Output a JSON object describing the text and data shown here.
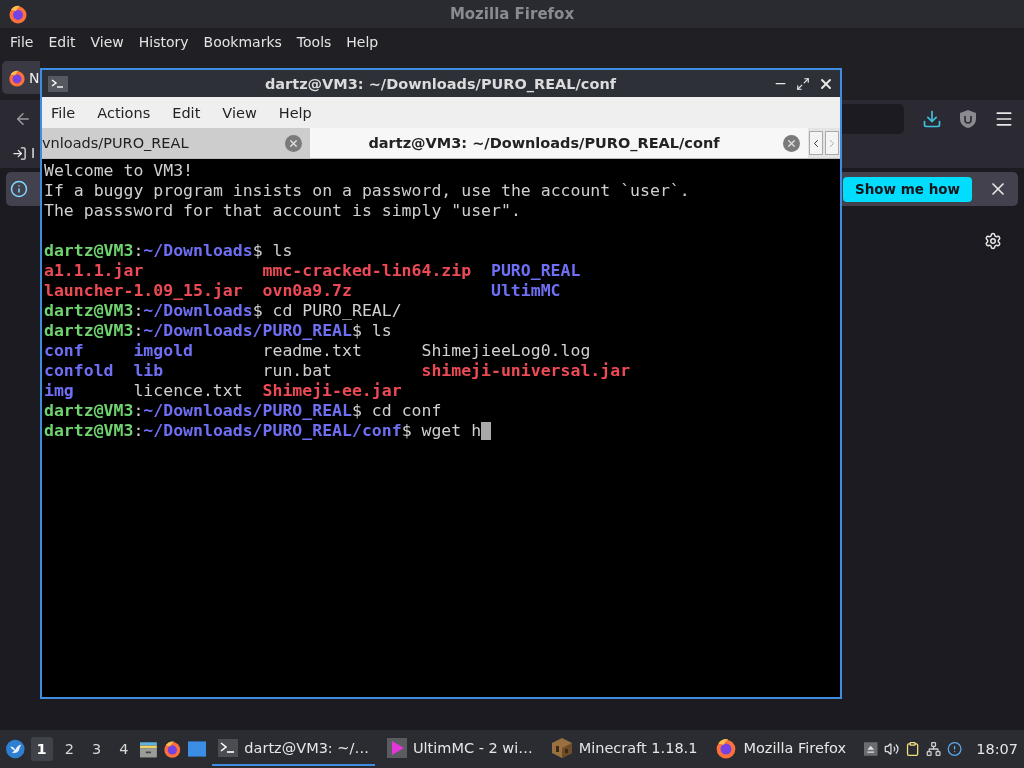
{
  "firefox": {
    "title": "Mozilla Firefox",
    "menu": [
      "File",
      "Edit",
      "View",
      "History",
      "Bookmarks",
      "Tools",
      "Help"
    ],
    "tab": {
      "label": "N",
      "selected": true
    },
    "bookmark": {
      "label": "I"
    },
    "notification": {
      "button": "Show me how"
    }
  },
  "terminal": {
    "title": "dartz@VM3: ~/Downloads/PURO_REAL/conf",
    "menu": [
      "File",
      "Actions",
      "Edit",
      "View",
      "Help"
    ],
    "tabs": [
      {
        "label": "vnloads/PURO_REAL",
        "selected": false
      },
      {
        "label": "dartz@VM3: ~/Downloads/PURO_REAL/conf",
        "selected": true
      }
    ],
    "lines": [
      {
        "kind": "text",
        "text": "Welcome to VM3!"
      },
      {
        "kind": "text",
        "text": "If a buggy program insists on a password, use the account `user`."
      },
      {
        "kind": "text",
        "text": "The passsword for that account is simply \"user\"."
      },
      {
        "kind": "blank"
      },
      {
        "kind": "prompt",
        "user": "dartz@VM3",
        "separator": ":",
        "path": "~/Downloads",
        "command": "$ ls",
        "cursor": false
      },
      {
        "kind": "listing",
        "rows": [
          [
            {
              "name": "a1.1.1.jar",
              "kind": "archive"
            },
            {
              "name": "mmc-cracked-lin64.zip",
              "kind": "archive"
            },
            {
              "name": "PURO_REAL",
              "kind": "dir"
            }
          ],
          [
            {
              "name": "launcher-1.09_15.jar",
              "kind": "archive"
            },
            {
              "name": "ovn0a9.7z",
              "kind": "archive"
            },
            {
              "name": "UltimMC",
              "kind": "dir"
            }
          ]
        ]
      },
      {
        "kind": "prompt",
        "user": "dartz@VM3",
        "separator": ":",
        "path": "~/Downloads",
        "command": "$ cd PURO_REAL/",
        "cursor": false
      },
      {
        "kind": "prompt",
        "user": "dartz@VM3",
        "separator": ":",
        "path": "~/Downloads/PURO_REAL",
        "command": "$ ls",
        "cursor": false
      },
      {
        "kind": "listing",
        "rows": [
          [
            {
              "name": "conf",
              "kind": "dir"
            },
            {
              "name": "imgold",
              "kind": "dir"
            },
            {
              "name": "readme.txt",
              "kind": "file"
            },
            {
              "name": "ShimejieeLog0.log",
              "kind": "file"
            }
          ],
          [
            {
              "name": "confold",
              "kind": "dir"
            },
            {
              "name": "lib",
              "kind": "dir"
            },
            {
              "name": "run.bat",
              "kind": "file"
            },
            {
              "name": "shimeji-universal.jar",
              "kind": "archive"
            }
          ],
          [
            {
              "name": "img",
              "kind": "dir"
            },
            {
              "name": "licence.txt",
              "kind": "file"
            },
            {
              "name": "Shimeji-ee.jar",
              "kind": "archive"
            }
          ]
        ]
      },
      {
        "kind": "prompt",
        "user": "dartz@VM3",
        "separator": ":",
        "path": "~/Downloads/PURO_REAL",
        "command": "$ cd conf",
        "cursor": false
      },
      {
        "kind": "prompt",
        "user": "dartz@VM3",
        "separator": ":",
        "path": "~/Downloads/PURO_REAL/conf",
        "command": "$ wget h",
        "cursor": true
      }
    ]
  },
  "taskbar": {
    "workspaces": [
      {
        "label": "1",
        "selected": true
      },
      {
        "label": "2",
        "selected": false
      },
      {
        "label": "3",
        "selected": false
      },
      {
        "label": "4",
        "selected": false
      }
    ],
    "tasks": [
      {
        "kind": "terminal",
        "label": "dartz@VM3: ~/…",
        "selected": true
      },
      {
        "kind": "launcher",
        "label": "UltimMC - 2 wi…",
        "selected": false
      },
      {
        "kind": "minecraft",
        "label": "Minecraft 1.18.1",
        "selected": false
      },
      {
        "kind": "firefox",
        "label": "Mozilla Firefox",
        "selected": false
      }
    ],
    "clock": "18:07"
  }
}
